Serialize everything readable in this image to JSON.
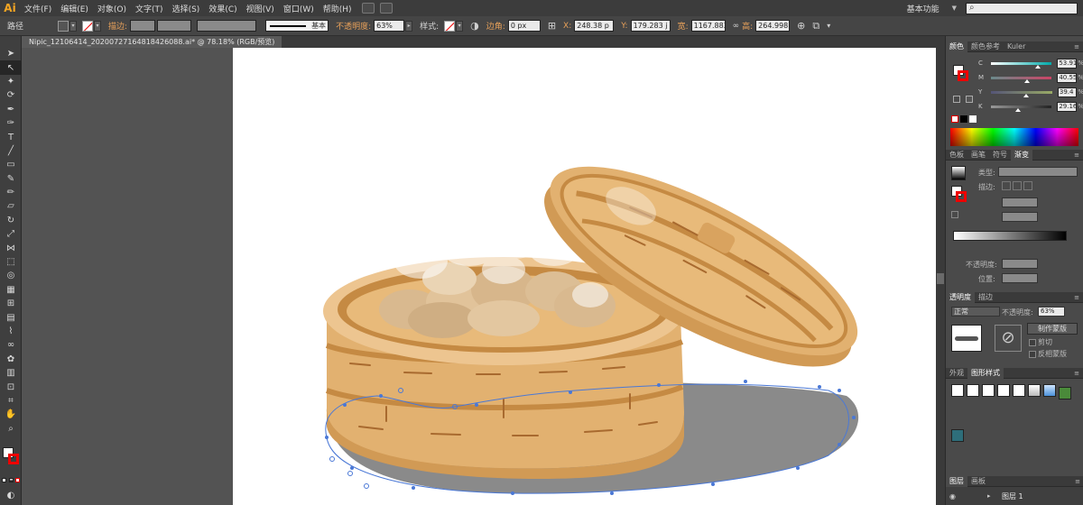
{
  "app": {
    "logo": "Ai"
  },
  "menu": [
    "文件(F)",
    "编辑(E)",
    "对象(O)",
    "文字(T)",
    "选择(S)",
    "效果(C)",
    "视图(V)",
    "窗口(W)",
    "帮助(H)"
  ],
  "workspace": "基本功能",
  "control": {
    "selection": "路径",
    "stroke_label": "描边:",
    "stroke_style": "基本",
    "opacity_label": "不透明度:",
    "opacity_value": "63%",
    "style_label": "样式:",
    "corner_label": "边角:",
    "corner_value": "0 px",
    "x_label": "X:",
    "x_value": "248.38 p",
    "y_label": "Y:",
    "y_value": "179.283 j",
    "w_label": "宽:",
    "w_value": "1167.883",
    "h_label": "高:",
    "h_value": "264.998 j"
  },
  "document": {
    "tab": "Nipic_12106414_20200727164818426088.ai* @ 78.18% (RGB/预览)"
  },
  "panels": {
    "color": {
      "tabs": [
        "颜色",
        "颜色参考",
        "Kuler"
      ],
      "channels": [
        {
          "label": "C",
          "value": "53.91",
          "knob": 0.73
        },
        {
          "label": "M",
          "value": "40.55",
          "knob": 0.55
        },
        {
          "label": "Y",
          "value": "39.4",
          "knob": 0.53
        },
        {
          "label": "K",
          "value": "29.16",
          "knob": 0.4
        }
      ],
      "unit": "%"
    },
    "gradient": {
      "tabs": [
        "色板",
        "画笔",
        "符号",
        "渐变"
      ],
      "type_label": "类型:",
      "stroke_label": "描边:",
      "opacity_label": "不透明度:",
      "position_label": "位置:"
    },
    "transparency": {
      "tabs": [
        "透明度",
        "描边"
      ],
      "blend": "正常",
      "opacity_label": "不透明度:",
      "opacity_value": "63%",
      "make_mask": "制作蒙版",
      "clip": "剪切",
      "invert": "反相蒙版"
    },
    "styles": {
      "tabs": [
        "外观",
        "图形样式"
      ]
    },
    "layers": {
      "tabs": [
        "图层",
        "画板"
      ],
      "layer_name": "图层 1"
    }
  },
  "colors": {
    "accent": "#e8a15a",
    "path": "#4a78d6",
    "bamboo": "#e2b170",
    "bamboo_dark": "#a86a2f",
    "shadow": "#8a8a8a"
  }
}
